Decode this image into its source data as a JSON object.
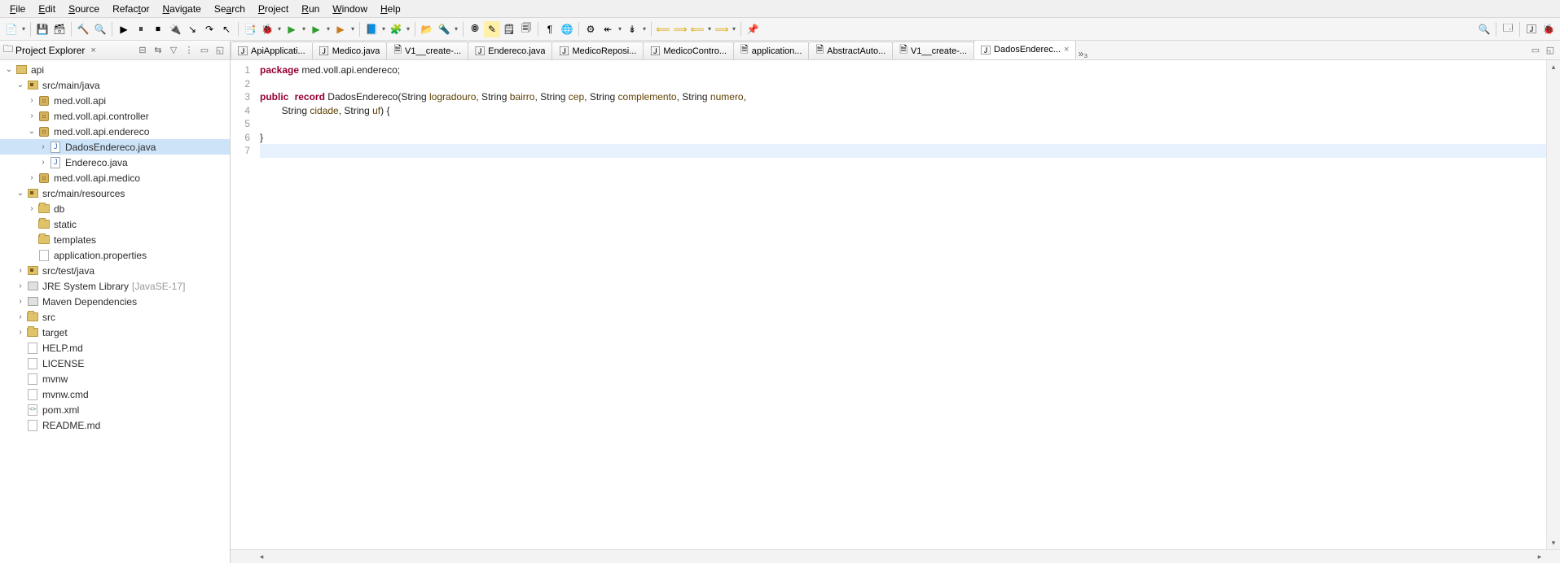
{
  "menubar": {
    "items": [
      {
        "label": "File",
        "mn": "F"
      },
      {
        "label": "Edit",
        "mn": "E"
      },
      {
        "label": "Source",
        "mn": "S"
      },
      {
        "label": "Refactor",
        "mn": "t"
      },
      {
        "label": "Navigate",
        "mn": "N"
      },
      {
        "label": "Search",
        "mn": "a"
      },
      {
        "label": "Project",
        "mn": "P"
      },
      {
        "label": "Run",
        "mn": "R"
      },
      {
        "label": "Window",
        "mn": "W"
      },
      {
        "label": "Help",
        "mn": "H"
      }
    ]
  },
  "project_panel": {
    "title": "Project Explorer"
  },
  "tree": {
    "root": "api",
    "srcMainJava": "src/main/java",
    "pkgApi": "med.voll.api",
    "pkgController": "med.voll.api.controller",
    "pkgEndereco": "med.voll.api.endereco",
    "fileDadosEndereco": "DadosEndereco.java",
    "fileEndereco": "Endereco.java",
    "pkgMedico": "med.voll.api.medico",
    "srcMainResources": "src/main/resources",
    "db": "db",
    "static": "static",
    "templates": "templates",
    "appProps": "application.properties",
    "srcTestJava": "src/test/java",
    "jreLabel": "JRE System Library",
    "jreExtra": "[JavaSE-17]",
    "mavenDeps": "Maven Dependencies",
    "src": "src",
    "target": "target",
    "help": "HELP.md",
    "license": "LICENSE",
    "mvnw": "mvnw",
    "mvnwCmd": "mvnw.cmd",
    "pom": "pom.xml",
    "readme": "README.md"
  },
  "tabs": [
    {
      "label": "ApiApplicati..."
    },
    {
      "label": "Medico.java"
    },
    {
      "label": "V1__create-..."
    },
    {
      "label": "Endereco.java"
    },
    {
      "label": "MedicoReposi..."
    },
    {
      "label": "MedicoContro..."
    },
    {
      "label": "application..."
    },
    {
      "label": "AbstractAuto..."
    },
    {
      "label": "V1__create-..."
    },
    {
      "label": "DadosEnderec...",
      "active": true
    }
  ],
  "gutter": [
    "1",
    "2",
    "3",
    "4",
    "5",
    "6",
    "7"
  ],
  "code": {
    "l1_kw": "package",
    "l1_rest": " med.voll.api.endereco;",
    "l3_kw1": "public",
    "l3_kw2": "record",
    "l3_a": " DadosEndereco(String ",
    "l3_p1": "logradouro",
    "l3_b": ", String ",
    "l3_p2": "bairro",
    "l3_c": ", String ",
    "l3_p3": "cep",
    "l3_d": ", String ",
    "l3_p4": "complemento",
    "l3_e": ", String ",
    "l3_p5": "numero",
    "l3_f": ",",
    "l4_a": "        String ",
    "l4_p1": "cidade",
    "l4_b": ", String ",
    "l4_p2": "uf",
    "l4_c": ") {",
    "l6": "}"
  }
}
